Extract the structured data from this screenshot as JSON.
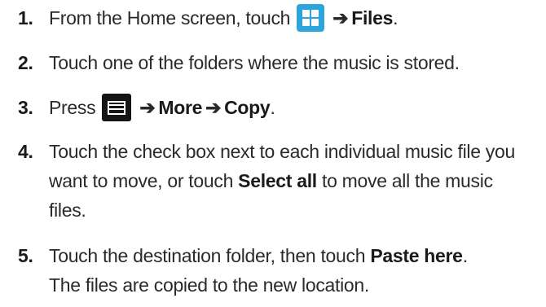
{
  "steps": [
    {
      "number": "1.",
      "pre": "From the Home screen, touch",
      "icon": "apps-grid-icon",
      "arrow": "➔",
      "bold": "Files",
      "post": "."
    },
    {
      "number": "2.",
      "text": "Touch one of the folders where the music is stored."
    },
    {
      "number": "3.",
      "pre": "Press",
      "icon": "menu-key-icon",
      "arrow1": "➔",
      "bold1": "More",
      "arrow2": "➔",
      "bold2": "Copy",
      "post": "."
    },
    {
      "number": "4.",
      "line1": "Touch the check box next to each individual music file you",
      "line2_pre": "want to move, or touch",
      "line2_bold": "Select all",
      "line2_post": "to move all the music",
      "line3": "files."
    },
    {
      "number": "5.",
      "line1_pre": "Touch the destination folder, then touch",
      "line1_bold": "Paste here",
      "line1_post": ".",
      "line2": "The files are copied to the new location."
    }
  ],
  "colors": {
    "apps_icon": "#2ba5dc",
    "menu_icon": "#141414",
    "text": "#2a2a2a"
  }
}
